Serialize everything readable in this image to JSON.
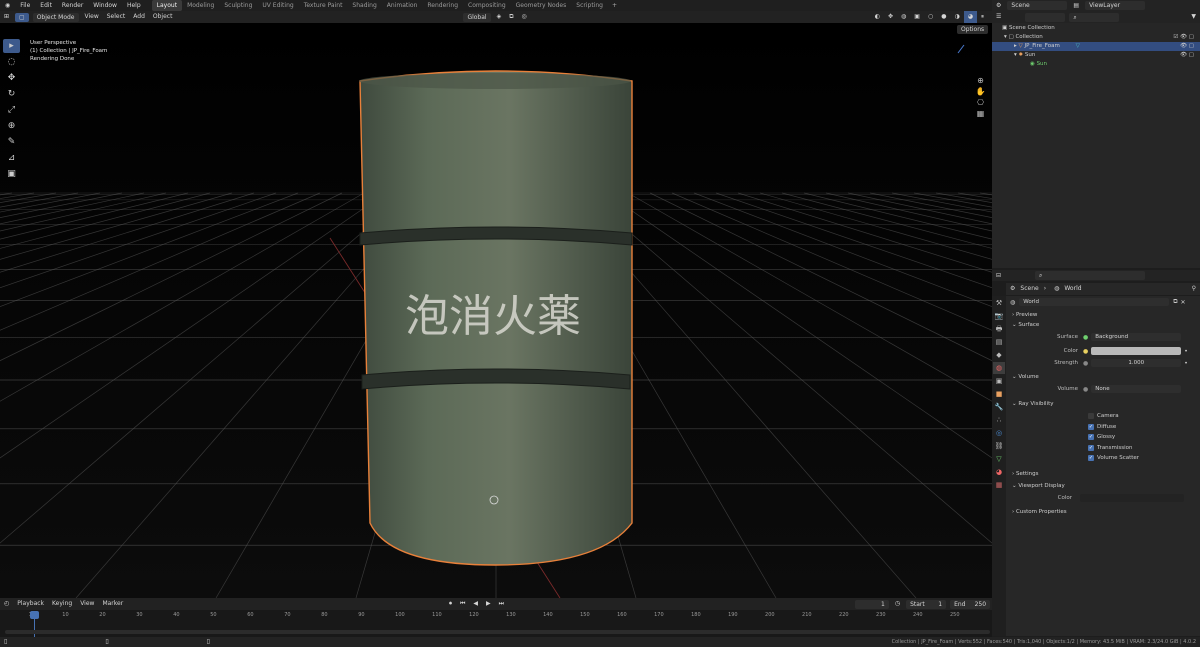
{
  "menu": [
    "File",
    "Edit",
    "Render",
    "Window",
    "Help"
  ],
  "workspaces": [
    "Layout",
    "Modeling",
    "Sculpting",
    "UV Editing",
    "Texture Paint",
    "Shading",
    "Animation",
    "Rendering",
    "Compositing",
    "Geometry Nodes",
    "Scripting"
  ],
  "active_workspace": "Layout",
  "top_right": {
    "scene": "Scene",
    "view_layer": "ViewLayer"
  },
  "viewport_header": {
    "mode": "Object Mode",
    "view": "View",
    "select": "Select",
    "add": "Add",
    "object": "Object",
    "orientation": "Global",
    "options": "Options"
  },
  "viewport_info": {
    "line1": "User Perspective",
    "line2": "(1) Collection | JP_Fire_Foam",
    "line3": "Rendering Done"
  },
  "barrel_text": "泡消火薬",
  "outliner": {
    "root": "Scene Collection",
    "collection": "Collection",
    "items": [
      {
        "name": "JP_Fire_Foam",
        "selected": true
      },
      {
        "name": "Sun",
        "selected": false
      },
      {
        "name": "Sun",
        "selected": false
      }
    ]
  },
  "properties": {
    "breadcrumb_scene": "Scene",
    "breadcrumb_world": "World",
    "world_name": "World",
    "preview": "Preview",
    "surface": {
      "title": "Surface",
      "surface_label": "Surface",
      "surface_value": "Background",
      "color_label": "Color",
      "strength_label": "Strength",
      "strength_value": "1.000"
    },
    "volume": {
      "title": "Volume",
      "label": "Volume",
      "value": "None"
    },
    "ray_visibility": {
      "title": "Ray Visibility",
      "items": [
        {
          "label": "Camera",
          "checked": false
        },
        {
          "label": "Diffuse",
          "checked": true
        },
        {
          "label": "Glossy",
          "checked": true
        },
        {
          "label": "Transmission",
          "checked": true
        },
        {
          "label": "Volume Scatter",
          "checked": true
        }
      ]
    },
    "settings": "Settings",
    "viewport_display": {
      "title": "Viewport Display",
      "color_label": "Color"
    },
    "custom_properties": "Custom Properties"
  },
  "timeline": {
    "playback": "Playback",
    "keying": "Keying",
    "view": "View",
    "marker": "Marker",
    "current_frame": "1",
    "start_label": "Start",
    "start": "1",
    "end_label": "End",
    "end": "250",
    "ticks": [
      "1",
      "10",
      "20",
      "30",
      "40",
      "50",
      "60",
      "70",
      "80",
      "90",
      "100",
      "110",
      "120",
      "130",
      "140",
      "150",
      "160",
      "170",
      "180",
      "190",
      "200",
      "210",
      "220",
      "230",
      "240",
      "250"
    ]
  },
  "status_bar": "Collection | JP_Fire_Foam | Verts:552 | Faces:540 | Tris:1,040 | Objects:1/2 | Memory: 43.5 MiB | VRAM: 2.3/24.0 GiB | 4.0.2",
  "colors": {
    "accent": "#4772b3",
    "selection_outline": "#e8803a",
    "barrel": "#56614f"
  }
}
